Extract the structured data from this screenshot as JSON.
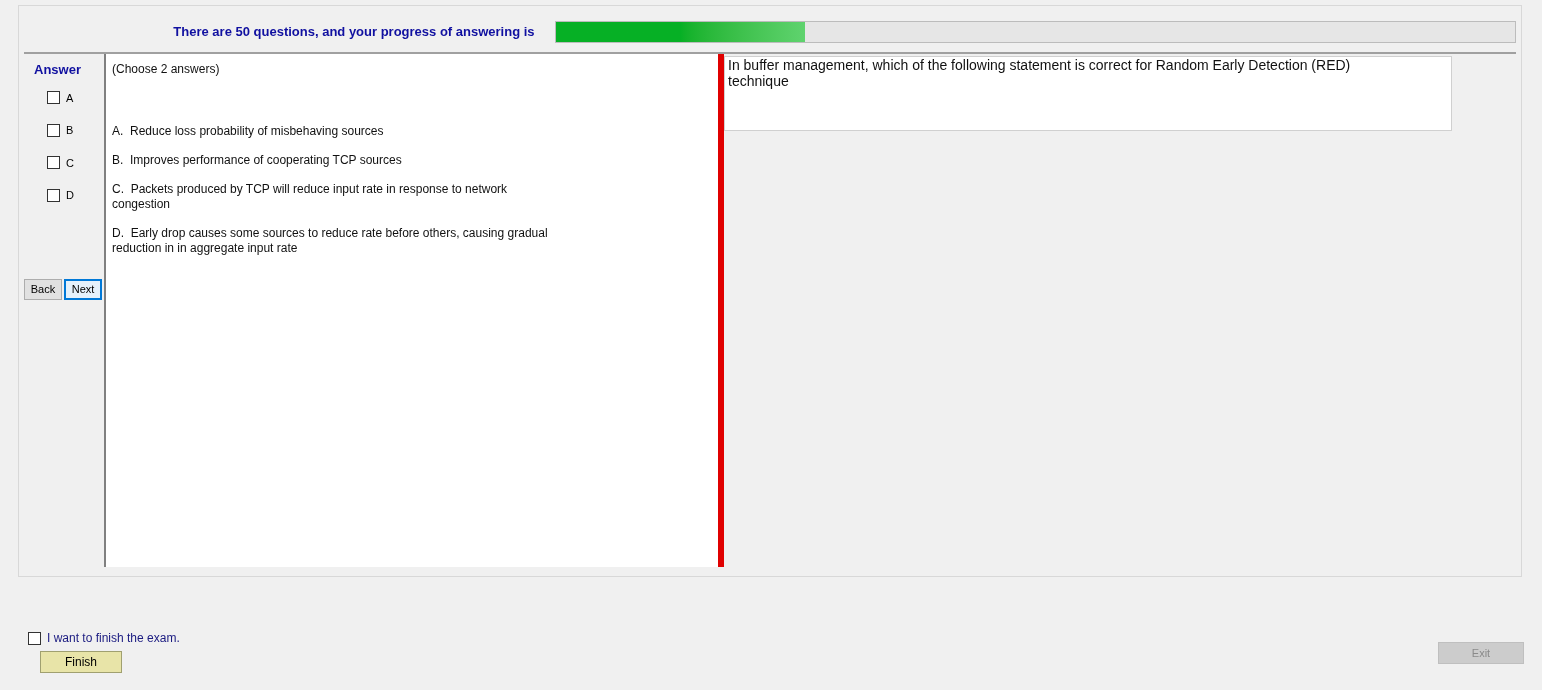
{
  "progress": {
    "label": "There are 50 questions, and your progress of answering is",
    "level": 0.26
  },
  "answer": {
    "title": "Answer",
    "choices": [
      {
        "label": "A",
        "checked": false
      },
      {
        "label": "B",
        "checked": false
      },
      {
        "label": "C",
        "checked": false
      },
      {
        "label": "D",
        "checked": false
      }
    ]
  },
  "navigation": {
    "back": "Back",
    "next": "Next"
  },
  "options": {
    "instruction": "(Choose 2 answers)",
    "items": [
      "A.  Reduce loss probability of misbehaving sources",
      "B.  Improves performance of cooperating TCP sources",
      "C.  Packets produced by TCP will reduce input rate in response to network congestion",
      "D.  Early drop causes some sources to reduce rate before others, causing gradual reduction in in aggregate input rate"
    ]
  },
  "question": "In buffer management, which of the following statement is correct for Random Early Detection (RED) technique",
  "finish": {
    "label": "I want to finish the exam.",
    "checked": false,
    "button": "Finish"
  },
  "exit": {
    "label": "Exit",
    "disabled": true
  }
}
